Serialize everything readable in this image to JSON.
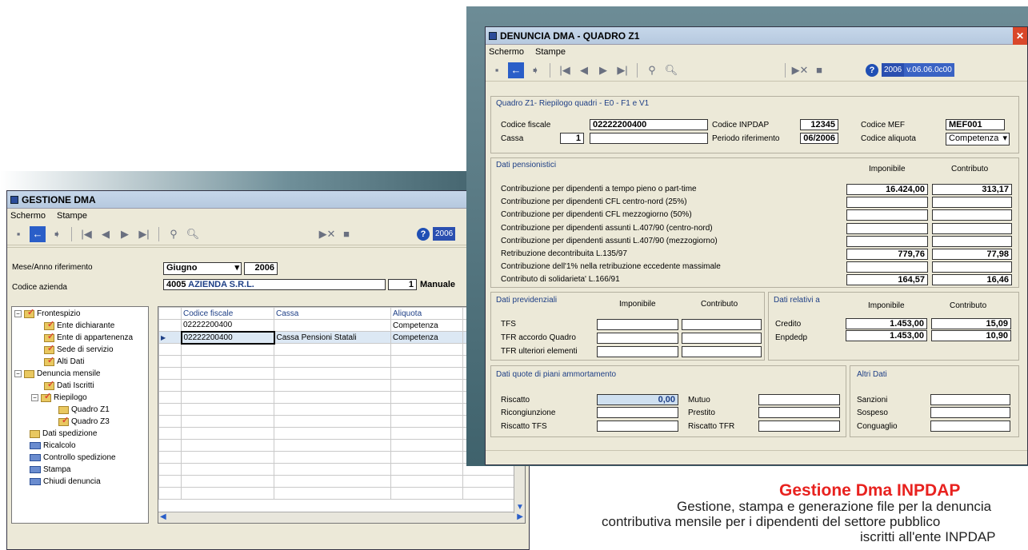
{
  "back_window": {
    "title": "GESTIONE DMA",
    "menu": [
      "Schermo",
      "Stampe"
    ],
    "version_label": "2006",
    "labels": {
      "period": "Mese/Anno riferimento",
      "azienda": "Codice azienda"
    },
    "month": "Giugno",
    "year": "2006",
    "azienda_code": "4005",
    "azienda_name": "AZIENDA S.R.L.",
    "mode_num": "1",
    "mode": "Manuale",
    "tree": [
      {
        "label": "Frontespizio",
        "level": 0,
        "icon": "folder-check-icon"
      },
      {
        "label": "Ente dichiarante",
        "level": 1,
        "icon": "folder-check-icon"
      },
      {
        "label": "Ente di appartenenza",
        "level": 1,
        "icon": "folder-check-icon"
      },
      {
        "label": "Sede di servizio",
        "level": 1,
        "icon": "folder-check-icon"
      },
      {
        "label": "Alti Dati",
        "level": 1,
        "icon": "folder-check-icon"
      },
      {
        "label": "Denuncia mensile",
        "level": 0,
        "icon": "folder-icon"
      },
      {
        "label": "Dati Iscritti",
        "level": 1,
        "icon": "folder-check-icon"
      },
      {
        "label": "Riepilogo",
        "level": 1,
        "icon": "folder-check-icon"
      },
      {
        "label": "Quadro Z1",
        "level": 2,
        "icon": "folder-icon"
      },
      {
        "label": "Quadro Z3",
        "level": 2,
        "icon": "folder-check-icon"
      },
      {
        "label": "Dati spedizione",
        "level": 0,
        "icon": "folder-icon"
      },
      {
        "label": "Ricalcolo",
        "level": 0,
        "icon": "doc-icon"
      },
      {
        "label": "Controllo spedizione",
        "level": 0,
        "icon": "doc-icon"
      },
      {
        "label": "Stampa",
        "level": 0,
        "icon": "doc-icon"
      },
      {
        "label": "Chiudi denuncia",
        "level": 0,
        "icon": "doc-icon"
      }
    ],
    "grid_headers": [
      "Codice fiscale",
      "Cassa",
      "Aliquota"
    ],
    "grid_rows": [
      [
        "02222200400",
        "",
        "Competenza"
      ],
      [
        "02222200400",
        "Cassa Pensioni Statali",
        "Competenza"
      ]
    ]
  },
  "front_window": {
    "title": "DENUNCIA DMA - QUADRO Z1",
    "menu": [
      "Schermo",
      "Stampe"
    ],
    "year": "2006",
    "version": "v.06.06.0c00",
    "section_title": "Quadro Z1- Riepilogo quadri - E0 - F1 e V1",
    "codice_fiscale_label": "Codice fiscale",
    "codice_fiscale": "02222200400",
    "codice_inpdap_label": "Codice INPDAP",
    "codice_inpdap": "12345",
    "codice_mef_label": "Codice MEF",
    "codice_mef": "MEF001",
    "cassa_label": "Cassa",
    "cassa": "1",
    "periodo_label": "Periodo riferimento",
    "periodo": "06/2006",
    "aliquota_label": "Codice aliquota",
    "aliquota": "Competenza",
    "pens_title": "Dati pensionistici",
    "col_imponibile": "Imponibile",
    "col_contributo": "Contributo",
    "pens_rows": [
      {
        "label": "Contribuzione per dipendenti a tempo pieno o part-time",
        "imp": "16.424,00",
        "contr": "313,17"
      },
      {
        "label": "Contribuzione per dipendenti CFL centro-nord (25%)",
        "imp": "",
        "contr": ""
      },
      {
        "label": "Contribuzione per dipendenti CFL mezzogiorno (50%)",
        "imp": "",
        "contr": ""
      },
      {
        "label": "Contribuzione per dipendenti assunti L.407/90 (centro-nord)",
        "imp": "",
        "contr": ""
      },
      {
        "label": "Contribuzione per dipendenti assunti L.407/90 (mezzogiorno)",
        "imp": "",
        "contr": ""
      },
      {
        "label": "Retribuzione decontribuita L.135/97",
        "imp": "779,76",
        "contr": "77,98"
      },
      {
        "label": "Contribuzione dell'1% nella retribuzione eccedente massimale",
        "imp": "",
        "contr": ""
      },
      {
        "label": "Contributo di solidarieta' L.166/91",
        "imp": "164,57",
        "contr": "16,46"
      }
    ],
    "prev_title": "Dati previdenziali",
    "prev_rows": [
      "TFS",
      "TFR accordo Quadro",
      "TFR ulteriori elementi"
    ],
    "rel_title": "Dati relativi a",
    "rel_rows": [
      {
        "label": "Credito",
        "imp": "1.453,00",
        "contr": "15,09"
      },
      {
        "label": "Enpdedp",
        "imp": "1.453,00",
        "contr": "10,90"
      }
    ],
    "quote_title": "Dati quote di piani ammortamento",
    "quote_left": [
      {
        "label": "Riscatto",
        "value": "0,00"
      },
      {
        "label": "Ricongiunzione",
        "value": ""
      },
      {
        "label": "Riscatto TFS",
        "value": ""
      }
    ],
    "quote_mid": [
      "Mutuo",
      "Prestito",
      "Riscatto TFR"
    ],
    "altri_title": "Altri Dati",
    "altri_rows": [
      "Sanzioni",
      "Sospeso",
      "Conguaglio"
    ]
  },
  "caption": {
    "title": "Gestione Dma INPDAP",
    "line1": "Gestione, stampa e generazione file per la denuncia",
    "line2": "contributiva mensile per i dipendenti del settore pubblico",
    "line3": "iscritti all'ente INPDAP"
  }
}
